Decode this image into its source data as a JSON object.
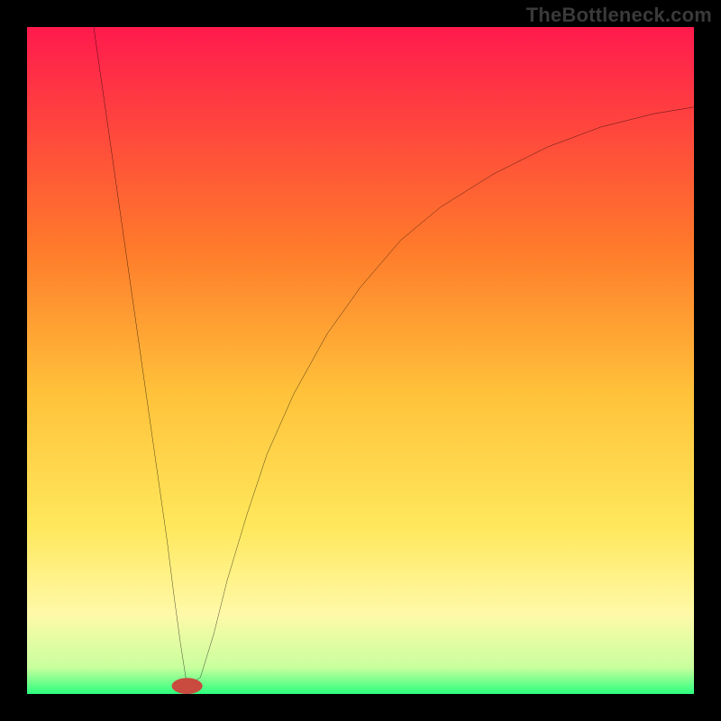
{
  "watermark": "TheBottleneck.com",
  "chart_data": {
    "type": "line",
    "title": "",
    "xlabel": "",
    "ylabel": "",
    "xlim": [
      0,
      100
    ],
    "ylim": [
      0,
      100
    ],
    "gradient_stops": [
      {
        "offset": 0,
        "color": "#ff1a4d"
      },
      {
        "offset": 33,
        "color": "#ff7a2b"
      },
      {
        "offset": 55,
        "color": "#ffc23a"
      },
      {
        "offset": 75,
        "color": "#ffe85c"
      },
      {
        "offset": 88,
        "color": "#fff9a8"
      },
      {
        "offset": 96,
        "color": "#c9ff9e"
      },
      {
        "offset": 100,
        "color": "#2cff7d"
      }
    ],
    "marker": {
      "x": 24,
      "y": 1.2,
      "rx": 2.3,
      "ry": 1.2,
      "color": "#c94a3f"
    },
    "series": [
      {
        "name": "curve",
        "points": [
          {
            "x": 10,
            "y": 100
          },
          {
            "x": 11,
            "y": 93
          },
          {
            "x": 12,
            "y": 86
          },
          {
            "x": 13,
            "y": 79
          },
          {
            "x": 14,
            "y": 72
          },
          {
            "x": 15,
            "y": 65
          },
          {
            "x": 16,
            "y": 58
          },
          {
            "x": 17,
            "y": 51
          },
          {
            "x": 18,
            "y": 44
          },
          {
            "x": 19,
            "y": 37
          },
          {
            "x": 20,
            "y": 30
          },
          {
            "x": 21,
            "y": 23
          },
          {
            "x": 22,
            "y": 15
          },
          {
            "x": 23,
            "y": 7.6
          },
          {
            "x": 24,
            "y": 1.2
          },
          {
            "x": 26,
            "y": 2.5
          },
          {
            "x": 28,
            "y": 9
          },
          {
            "x": 30,
            "y": 17
          },
          {
            "x": 33,
            "y": 27
          },
          {
            "x": 36,
            "y": 36
          },
          {
            "x": 40,
            "y": 45
          },
          {
            "x": 45,
            "y": 54
          },
          {
            "x": 50,
            "y": 61
          },
          {
            "x": 56,
            "y": 68
          },
          {
            "x": 62,
            "y": 73
          },
          {
            "x": 70,
            "y": 78
          },
          {
            "x": 78,
            "y": 82
          },
          {
            "x": 86,
            "y": 85
          },
          {
            "x": 94,
            "y": 87
          },
          {
            "x": 100,
            "y": 88
          }
        ]
      }
    ]
  }
}
